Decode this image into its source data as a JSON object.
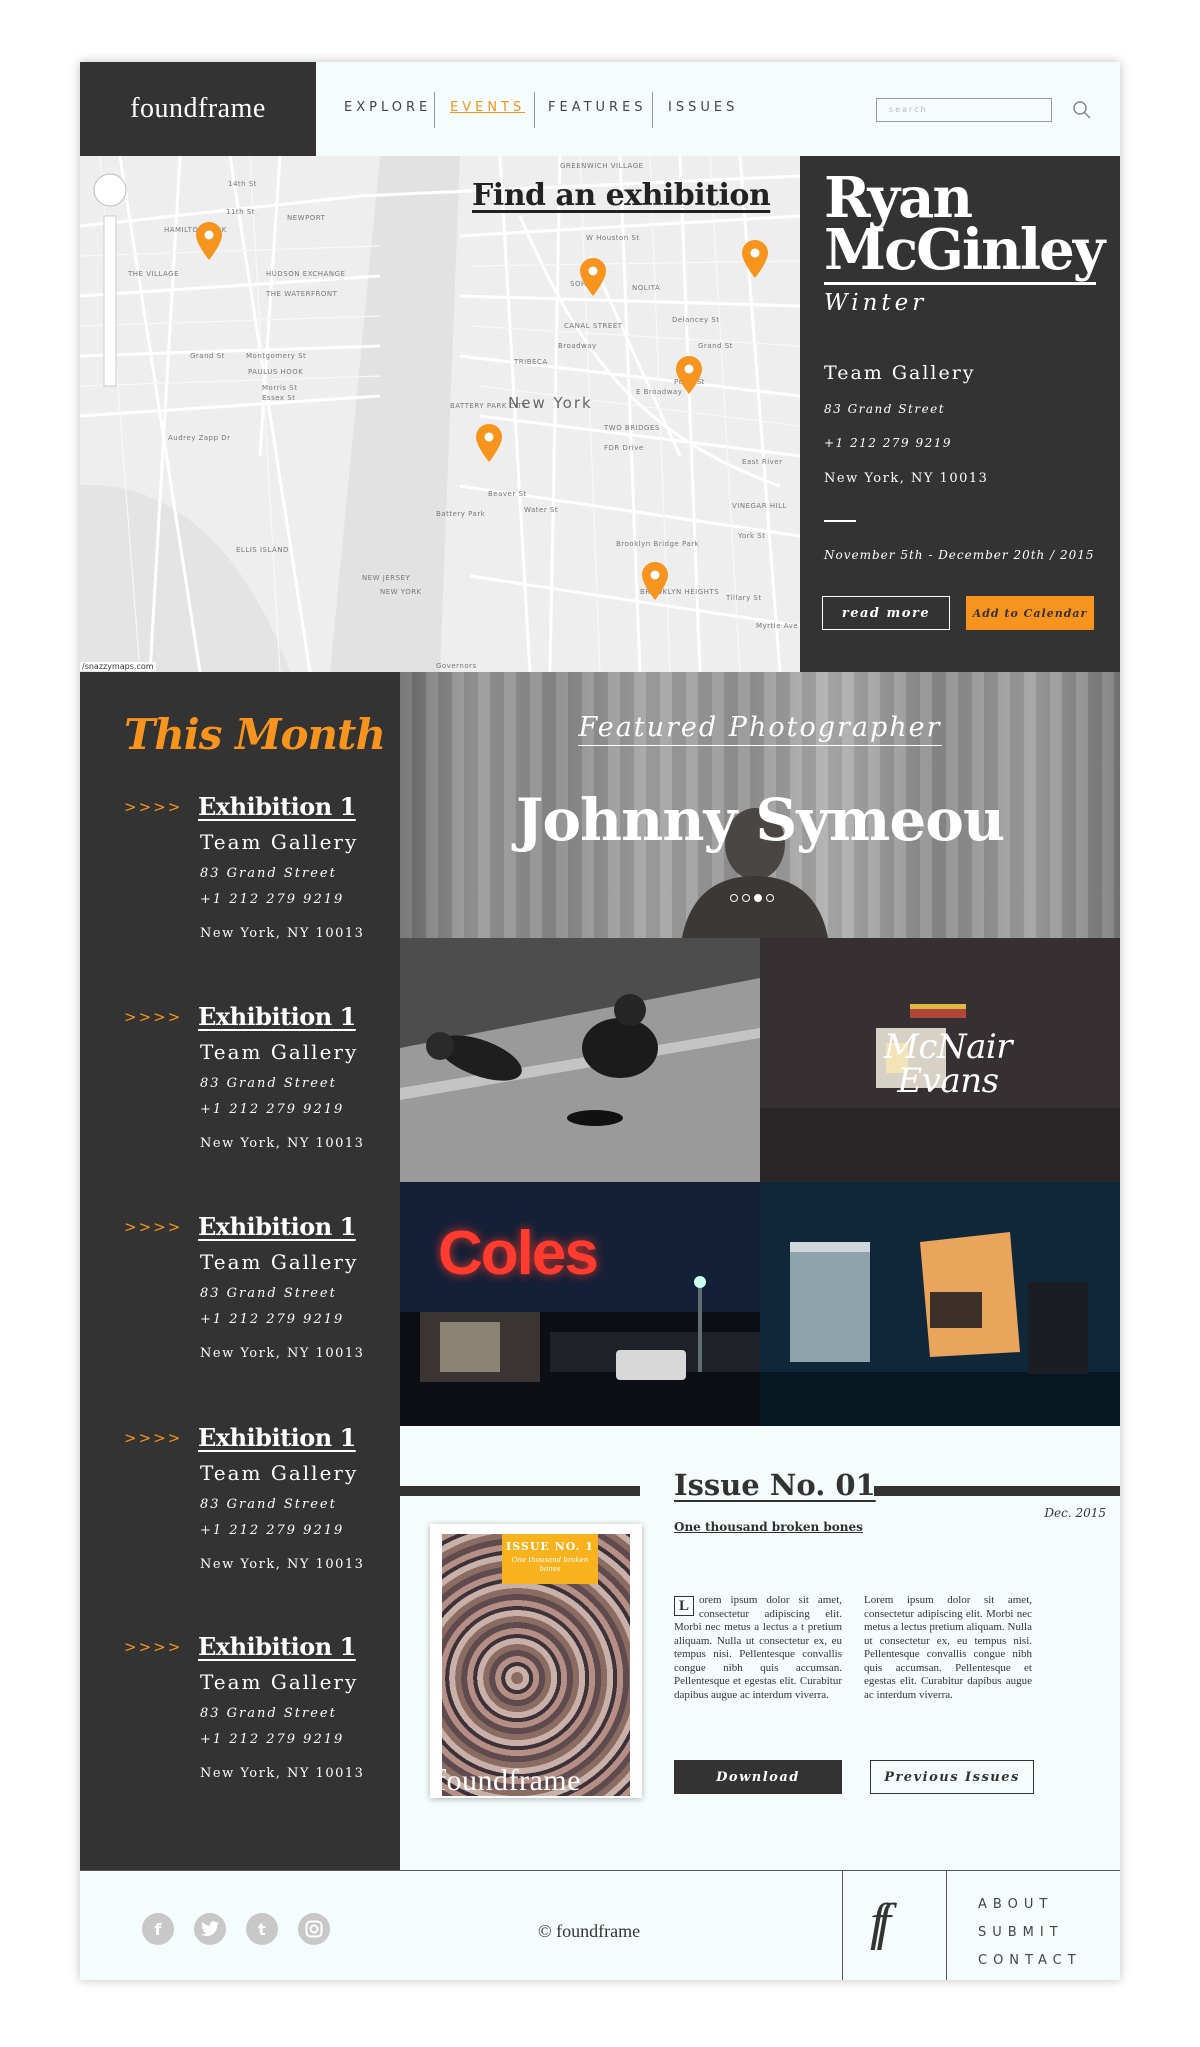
{
  "brand": "foundframe",
  "nav": {
    "items": [
      "EXPLORE",
      "EVENTS",
      "FEATURES",
      "ISSUES"
    ],
    "active": "EVENTS",
    "search_placeholder": "search"
  },
  "map": {
    "title": "Find an exhibition",
    "city_label": "New York",
    "credit": "/snazzymaps.com",
    "street_labels": [
      "14th St",
      "11th St",
      "NEWPORT",
      "HAMILTON PARK",
      "THE VILLAGE",
      "HUDSON EXCHANGE",
      "THE WATERFRONT",
      "Grand St",
      "Montgomery St",
      "PAULUS HOOK",
      "Morris St",
      "Essex St",
      "Audrey Zapp Dr",
      "ELLIS ISLAND",
      "NEW JERSEY",
      "NEW YORK",
      "GREENWICH VILLAGE",
      "W Houston St",
      "SOHO",
      "NOLITA",
      "CANAL STREET",
      "TRIBECA",
      "Broadway",
      "Delancey St",
      "Grand St",
      "E Broadway",
      "TWO BRIDGES",
      "BATTERY PARK CITY",
      "FDR Drive",
      "East River",
      "VINEGAR HILL",
      "York St",
      "Brooklyn Bridge Park",
      "BROOKLYN HEIGHTS",
      "Tillary St",
      "Myrtle Ave",
      "Governors",
      "Battery Park",
      "Beaver St",
      "Water St",
      "Pearl St"
    ]
  },
  "featured_event": {
    "artist": "Ryan McGinley",
    "title": "Winter",
    "gallery": "Team Gallery",
    "street": "83 Grand Street",
    "phone": "+1 212 279 9219",
    "city": "New York, NY 10013",
    "dates": "November 5th - December 20th / 2015",
    "read_more": "read more",
    "add_calendar": "Add to Calendar"
  },
  "this_month": {
    "title": "This Month",
    "arrow": ">>>>",
    "exhibitions": [
      {
        "name": "Exhibition 1",
        "gallery": "Team Gallery",
        "street": "83 Grand Street",
        "phone": "+1 212 279 9219",
        "city": "New York, NY 10013"
      },
      {
        "name": "Exhibition 1",
        "gallery": "Team Gallery",
        "street": "83 Grand Street",
        "phone": "+1 212 279 9219",
        "city": "New York, NY 10013"
      },
      {
        "name": "Exhibition 1",
        "gallery": "Team Gallery",
        "street": "83 Grand Street",
        "phone": "+1 212 279 9219",
        "city": "New York, NY 10013"
      },
      {
        "name": "Exhibition 1",
        "gallery": "Team Gallery",
        "street": "83 Grand Street",
        "phone": "+1 212 279 9219",
        "city": "New York, NY 10013"
      },
      {
        "name": "Exhibition 1",
        "gallery": "Team Gallery",
        "street": "83 Grand Street",
        "phone": "+1 212 279 9219",
        "city": "New York, NY 10013"
      }
    ]
  },
  "hero": {
    "kicker": "Featured Photographer",
    "name": "Johnny Symeou",
    "slides": 4,
    "active_slide": 3
  },
  "tiles": {
    "tile2_label_line1": "McNair",
    "tile2_label_line2": "Evans",
    "tile3_sign": "Coles"
  },
  "issue": {
    "title": "Issue No. 01",
    "subtitle": "One thousand broken bones",
    "date": "Dec. 2015",
    "cover_badge": "ISSUE NO. 1",
    "cover_badge_sub": "One thousand broken bones",
    "cover_brand": "foundframe",
    "dropcap": "L",
    "col1": "orem ipsum dolor sit amet, consectetur adipiscing elit. Morbi nec metus a lectus a t pretium aliquam. Nulla ut consectetur ex, eu tempus nisi. Pellentesque convallis congue nibh quis accumsan. Pellentesque et egestas elit. Curabitur dapibus augue ac interdum viverra.",
    "col2": "Lorem ipsum dolor sit amet, consectetur adipiscing elit. Morbi nec metus a lectus pretium aliquam. Nulla ut consectetur ex, eu tempus nisi. Pellentesque convallis congue nibh quis accumsan. Pellentesque et egestas elit. Curabitur dapibus augue ac interdum viverra.",
    "download": "Download",
    "previous": "Previous Issues"
  },
  "footer": {
    "social": [
      "facebook-icon",
      "twitter-icon",
      "tumblr-icon",
      "instagram-icon"
    ],
    "copyright": "© foundframe",
    "monogram": "ff",
    "links": [
      "ABOUT",
      "SUBMIT",
      "CONTACT"
    ]
  },
  "colors": {
    "accent": "#f7941d",
    "dark": "#333333",
    "bg": "#f4fcfc"
  }
}
